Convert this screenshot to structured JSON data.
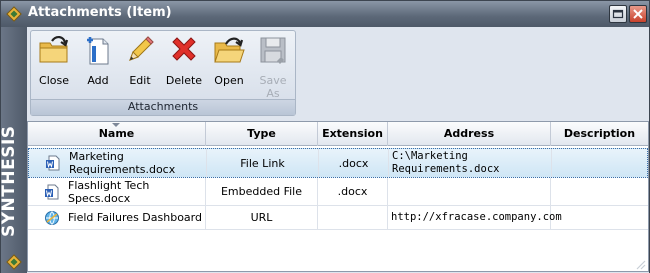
{
  "window": {
    "title": "Attachments (Item)"
  },
  "sidebar": {
    "brand": "SYNTHESIS"
  },
  "ribbon": {
    "group_label": "Attachments",
    "buttons": [
      {
        "label": "Close",
        "icon": "folder-arrow-icon",
        "enabled": true
      },
      {
        "label": "Add",
        "icon": "add-document-icon",
        "enabled": true
      },
      {
        "label": "Edit",
        "icon": "pencil-icon",
        "enabled": true
      },
      {
        "label": "Delete",
        "icon": "red-x-icon",
        "enabled": true
      },
      {
        "label": "Open",
        "icon": "open-folder-icon",
        "enabled": true
      },
      {
        "label": "Save As",
        "icon": "floppy-disk-icon",
        "enabled": false
      }
    ]
  },
  "table": {
    "columns": [
      "Name",
      "Type",
      "Extension",
      "Address",
      "Description"
    ],
    "rows": [
      {
        "name": "Marketing Requirements.docx",
        "type": "File Link",
        "extension": ".docx",
        "address": "C:\\Marketing Requirements.docx",
        "description": "",
        "icon": "word-document-icon",
        "selected": true
      },
      {
        "name": "Flashlight Tech Specs.docx",
        "type": "Embedded File",
        "extension": ".docx",
        "address": "",
        "description": "",
        "icon": "word-document-icon",
        "selected": false
      },
      {
        "name": "Field Failures Dashboard",
        "type": "URL",
        "extension": "",
        "address": "http://xfracase.company.com",
        "description": "",
        "icon": "web-link-icon",
        "selected": false
      }
    ]
  },
  "colors": {
    "selection": "#cfe6f5",
    "sidebar": "#5f6a78",
    "ribbon": "#dfe5ee"
  }
}
